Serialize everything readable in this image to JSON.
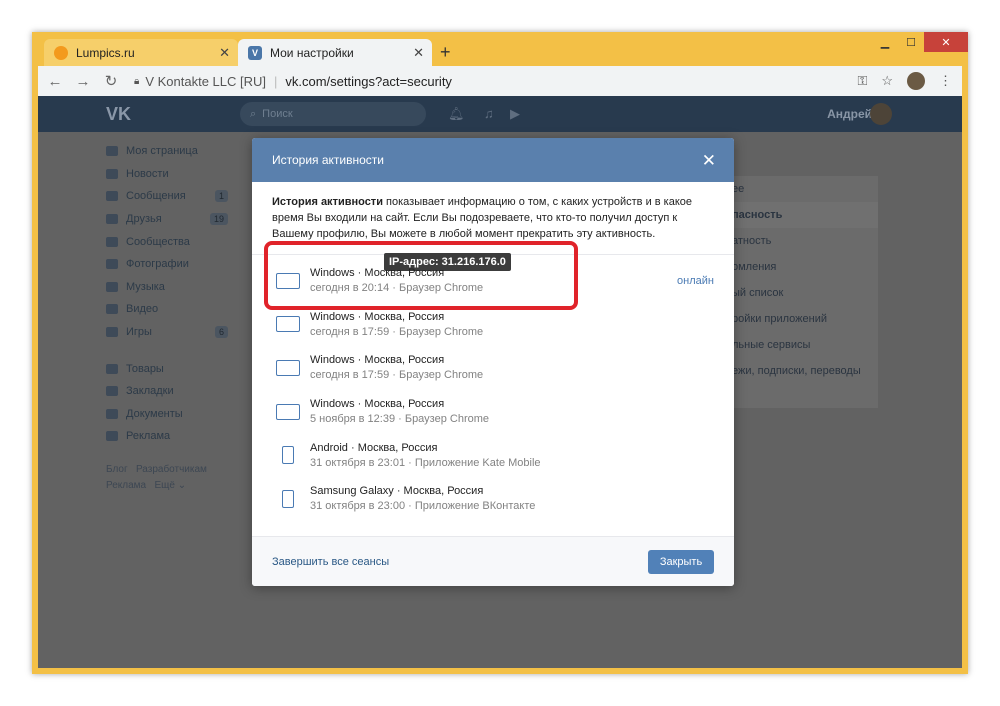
{
  "browser": {
    "tabs": [
      {
        "title": "Lumpics.ru"
      },
      {
        "title": "Мои настройки"
      }
    ],
    "address": {
      "site": "V Kontakte LLC [RU]",
      "url": "vk.com/settings?act=security"
    }
  },
  "vk": {
    "search_placeholder": "Поиск",
    "user_name": "Андрей",
    "sidebar": [
      {
        "label": "Моя страница",
        "count": ""
      },
      {
        "label": "Новости",
        "count": ""
      },
      {
        "label": "Сообщения",
        "count": "1"
      },
      {
        "label": "Друзья",
        "count": "19"
      },
      {
        "label": "Сообщества",
        "count": ""
      },
      {
        "label": "Фотографии",
        "count": ""
      },
      {
        "label": "Музыка",
        "count": ""
      },
      {
        "label": "Видео",
        "count": ""
      },
      {
        "label": "Игры",
        "count": "6"
      }
    ],
    "sidebar2": [
      {
        "label": "Товары"
      },
      {
        "label": "Закладки"
      },
      {
        "label": "Документы"
      },
      {
        "label": "Реклама"
      }
    ],
    "footer": {
      "l1": "Блог",
      "l2": "Разработчикам",
      "l3": "Реклама",
      "l4": "Ещё ⌄"
    },
    "settings_menu": [
      "ее",
      "пасность",
      "атность",
      "омления",
      "ый список",
      "ройки приложений",
      "льные сервисы",
      "ежи, подписки, переводы"
    ]
  },
  "modal": {
    "title": "История активности",
    "desc_bold": "История активности",
    "desc_rest": " показывает информацию о том, с каких устройств и в какое время Вы входили на сайт. Если Вы подозреваете, что кто-то получил доступ к Вашему профилю, Вы можете в любой момент прекратить эту активность.",
    "tooltip": "IP-адрес: 31.216.176.0",
    "online": "онлайн",
    "sessions": [
      {
        "device": "Windows",
        "place": "Москва, Россия",
        "time": "сегодня в 20:14",
        "client": "Браузер Chrome",
        "icon": "laptop-icon"
      },
      {
        "device": "Windows",
        "place": "Москва, Россия",
        "time": "сегодня в 17:59",
        "client": "Браузер Chrome",
        "icon": "laptop-icon"
      },
      {
        "device": "Windows",
        "place": "Москва, Россия",
        "time": "сегодня в 17:59",
        "client": "Браузер Chrome",
        "icon": "laptop-icon"
      },
      {
        "device": "Windows",
        "place": "Москва, Россия",
        "time": "5 ноября в 12:39",
        "client": "Браузер Chrome",
        "icon": "laptop-icon"
      },
      {
        "device": "Android",
        "place": "Москва, Россия",
        "time": "31 октября в 23:01",
        "client": "Приложение Kate Mobile",
        "icon": "android-phone-icon"
      },
      {
        "device": "Samsung Galaxy",
        "place": "Москва, Россия",
        "time": "31 октября в 23:00",
        "client": "Приложение ВКонтакте",
        "icon": "android-phone-icon"
      }
    ],
    "end_all": "Завершить все сеансы",
    "close": "Закрыть"
  },
  "colors": {
    "accent": "#5181b8",
    "highlight": "#e0232a",
    "header": "#5a80ad"
  }
}
